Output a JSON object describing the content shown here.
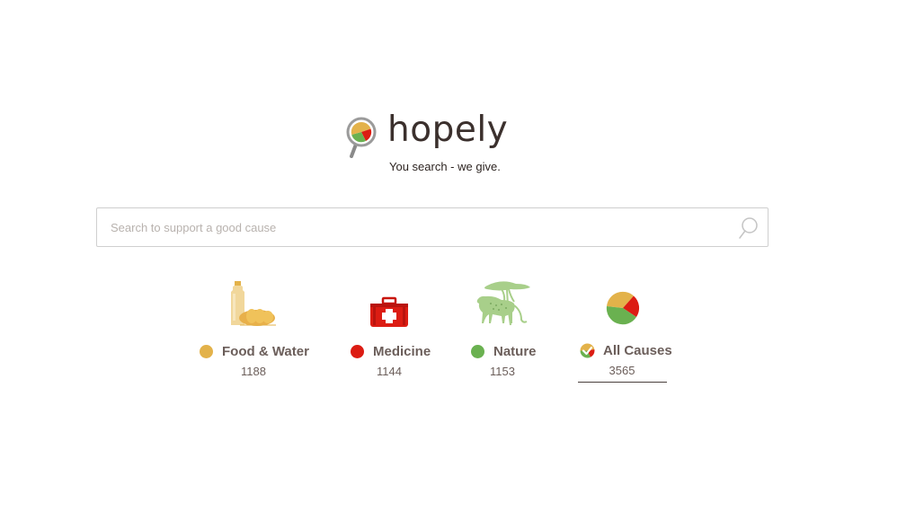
{
  "brand": {
    "name": "hopely",
    "tagline": "You search - we give."
  },
  "search": {
    "placeholder": "Search to support a good cause",
    "value": ""
  },
  "colors": {
    "food": "#e3b24a",
    "medicine": "#dc1c13",
    "nature": "#6ab150"
  },
  "causes": [
    {
      "label": "Food & Water",
      "count": "1188",
      "icon": "bottle-bread-icon",
      "color": "#e3b24a"
    },
    {
      "label": "Medicine",
      "count": "1144",
      "icon": "medical-suitcase-icon",
      "color": "#dc1c13"
    },
    {
      "label": "Nature",
      "count": "1153",
      "icon": "cheetah-tree-icon",
      "color": "#6ab150"
    },
    {
      "label": "All Causes",
      "count": "3565",
      "icon": "pie-chart-icon",
      "selected": true
    }
  ]
}
